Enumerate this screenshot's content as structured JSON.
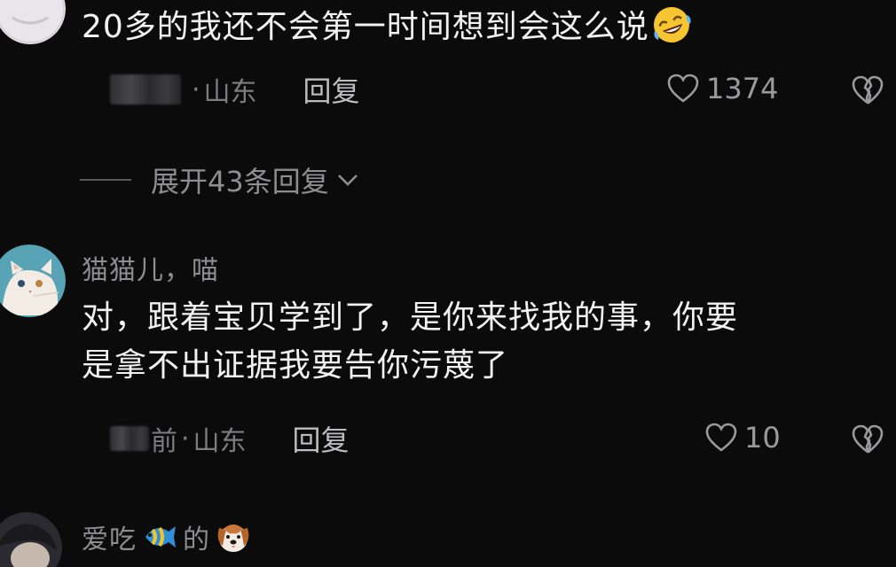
{
  "comments": [
    {
      "text": "20多的我还不会第一时间想到会这么说",
      "emoji": "rofl-emoji",
      "location": "山东",
      "reply_label": "回复",
      "likes": "1374"
    },
    {
      "username": "猫猫儿，喵",
      "text_line1": "对，跟着宝贝学到了，是你来找我的事，你要",
      "text_line2": "是拿不出证据我要告你污蔑了",
      "meta_prefix": "前",
      "location": "山东",
      "reply_label": "回复",
      "likes": "10"
    },
    {
      "username_part1": "爱吃",
      "username_part2": "的",
      "emoji1": "tropical-fish-emoji",
      "emoji2": "dog-face-emoji"
    }
  ],
  "expand_replies": {
    "label": "展开43条回复"
  },
  "colors": {
    "background": "#0b0b0c",
    "primary_text": "#f2f2f2",
    "secondary_text": "#8d8d8f"
  }
}
